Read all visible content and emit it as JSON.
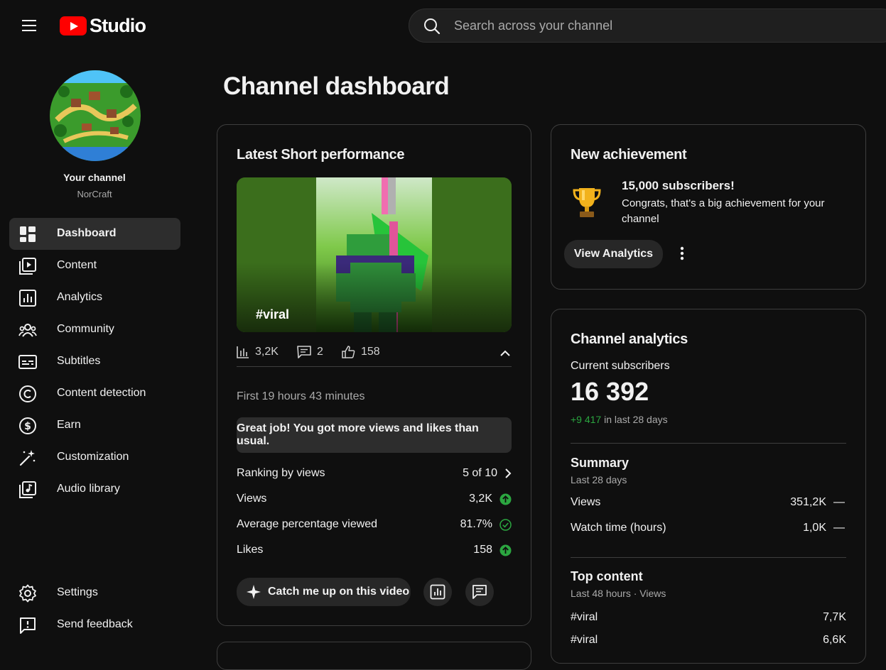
{
  "header": {
    "logo_text": "Studio",
    "search_placeholder": "Search across your channel"
  },
  "sidebar": {
    "channel_title": "Your channel",
    "channel_name": "NorCraft",
    "items": [
      {
        "label": "Dashboard",
        "icon": "dashboard-icon",
        "active": true
      },
      {
        "label": "Content",
        "icon": "content-icon"
      },
      {
        "label": "Analytics",
        "icon": "analytics-icon"
      },
      {
        "label": "Community",
        "icon": "community-icon"
      },
      {
        "label": "Subtitles",
        "icon": "subtitles-icon"
      },
      {
        "label": "Content detection",
        "icon": "copyright-icon"
      },
      {
        "label": "Earn",
        "icon": "dollar-icon"
      },
      {
        "label": "Customization",
        "icon": "magic-wand-icon"
      },
      {
        "label": "Audio library",
        "icon": "audio-library-icon"
      }
    ],
    "footer_items": [
      {
        "label": "Settings",
        "icon": "gear-icon"
      },
      {
        "label": "Send feedback",
        "icon": "feedback-icon"
      }
    ]
  },
  "page_title": "Channel dashboard",
  "latest_short": {
    "title": "Latest Short performance",
    "thumbnail_tag": "#viral",
    "stats": {
      "views": "3,2K",
      "comments": "2",
      "likes": "158"
    },
    "period": "First 19 hours 43 minutes",
    "callout": "Great job! You got more views and likes than usual.",
    "rows": [
      {
        "label": "Ranking by views",
        "value": "5 of 10",
        "indicator": "chevron-right-icon"
      },
      {
        "label": "Views",
        "value": "3,2K",
        "indicator": "arrow-up-green-icon"
      },
      {
        "label": "Average percentage viewed",
        "value": "81.7%",
        "indicator": "check-circle-icon"
      },
      {
        "label": "Likes",
        "value": "158",
        "indicator": "arrow-up-green-icon"
      }
    ],
    "catch_up_label": "Catch me up on this video",
    "colors": {
      "green": "#2ba640"
    }
  },
  "achievement": {
    "title": "New achievement",
    "headline": "15,000 subscribers!",
    "body": "Congrats, that's a big achievement for your channel",
    "button": "View Analytics"
  },
  "channel_analytics": {
    "title": "Channel analytics",
    "subscribers_label": "Current subscribers",
    "subscribers_value": "16 392",
    "delta": "+9 417",
    "delta_suffix": " in last 28 days",
    "summary_title": "Summary",
    "summary_period": "Last 28 days",
    "summary_rows": [
      {
        "label": "Views",
        "value": "351,2K",
        "trend": "—"
      },
      {
        "label": "Watch time (hours)",
        "value": "1,0K",
        "trend": "—"
      }
    ],
    "top_content_title": "Top content",
    "top_content_period": "Last 48 hours · Views",
    "top_content_rows": [
      {
        "label": "#viral",
        "value": "7,7K"
      },
      {
        "label": "#viral",
        "value": "6,6K"
      }
    ]
  }
}
